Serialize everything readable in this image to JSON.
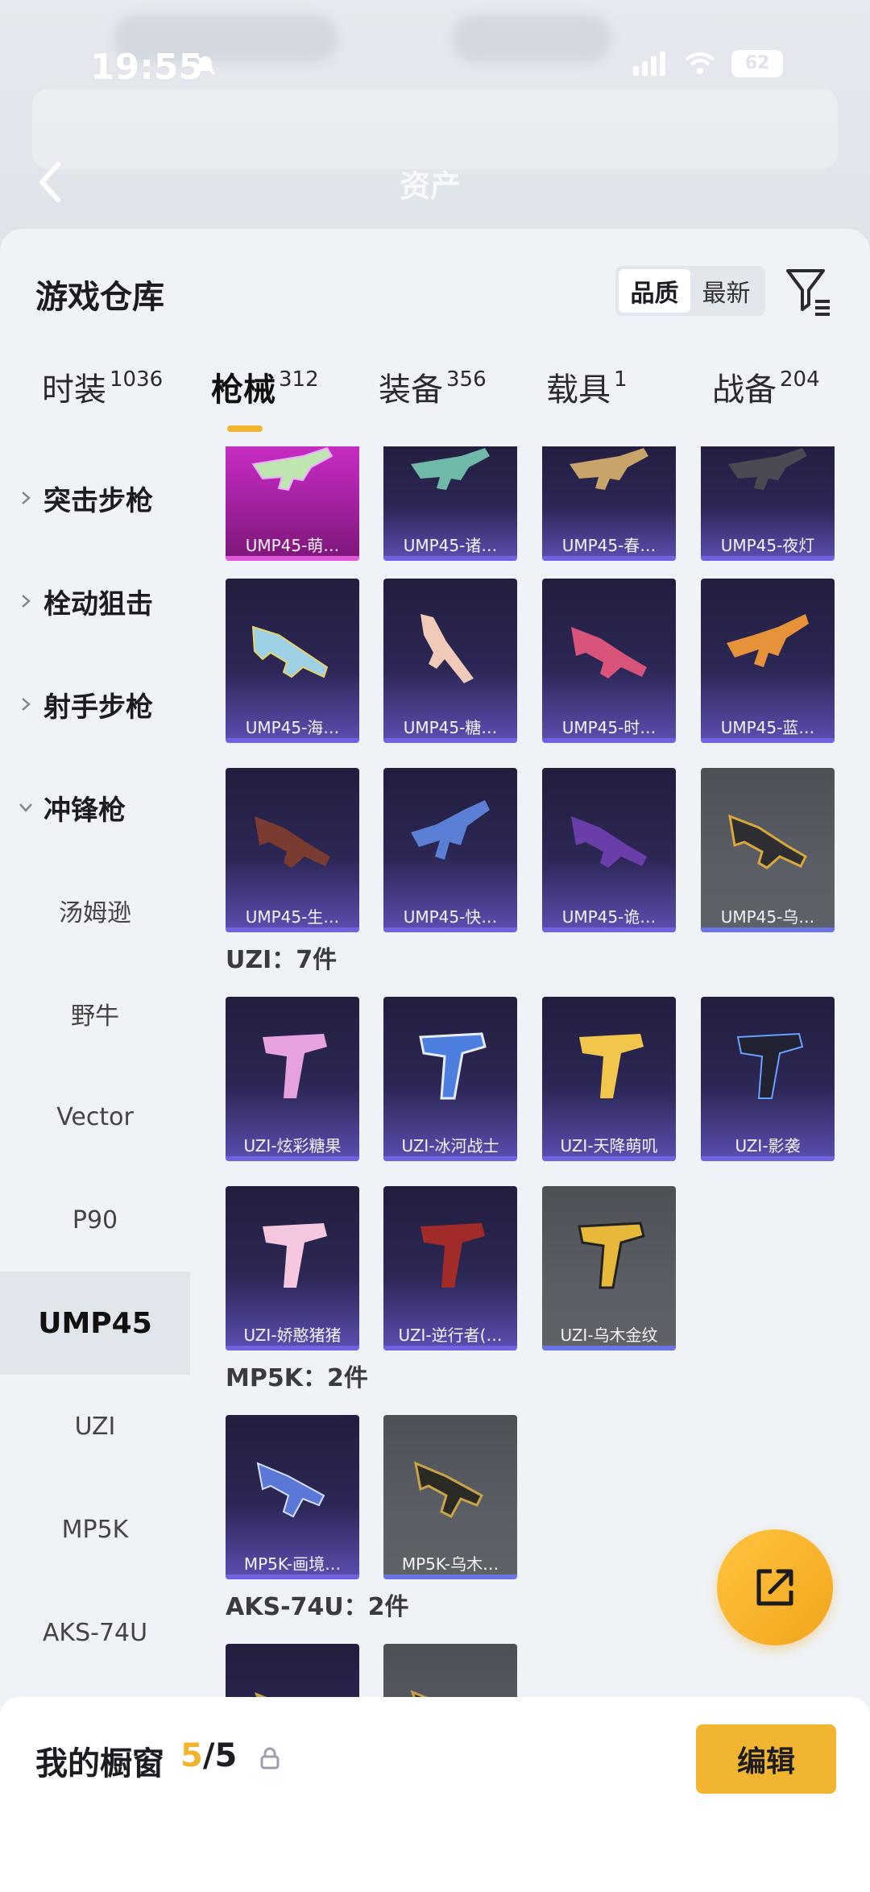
{
  "status": {
    "time": "19:55",
    "battery": "62"
  },
  "header_bg": {
    "left_text": "资产",
    "blurred": [
      "资产"
    ]
  },
  "sheet": {
    "title": "游戏仓库",
    "sort": {
      "options": [
        "品质",
        "最新"
      ],
      "selected": "品质"
    }
  },
  "tabs": [
    {
      "label": "时装",
      "count": "1036"
    },
    {
      "label": "枪械",
      "count": "312"
    },
    {
      "label": "装备",
      "count": "356"
    },
    {
      "label": "载具",
      "count": "1"
    },
    {
      "label": "战备",
      "count": "204"
    }
  ],
  "active_tab": "枪械",
  "sidebar": {
    "categories": [
      {
        "label": "突击步枪",
        "expanded": false
      },
      {
        "label": "栓动狙击",
        "expanded": false
      },
      {
        "label": "射手步枪",
        "expanded": false
      },
      {
        "label": "冲锋枪",
        "expanded": true
      }
    ],
    "subitems": [
      "汤姆逊",
      "野牛",
      "Vector",
      "P90",
      "UMP45",
      "UZI",
      "MP5K",
      "AKS-74U"
    ],
    "selected_sub": "UMP45"
  },
  "grid": {
    "ump_rows": [
      [
        "UMP45-萌…",
        "UMP45-诸…",
        "UMP45-春…",
        "UMP45-夜灯"
      ],
      [
        "UMP45-海…",
        "UMP45-糖…",
        "UMP45-时…",
        "UMP45-蓝…"
      ],
      [
        "UMP45-生…",
        "UMP45-快…",
        "UMP45-诡…",
        "UMP45-乌…"
      ]
    ],
    "uzi_title": "UZI：7件",
    "uzi_rows": [
      [
        "UZI-炫彩糖果",
        "UZI-冰河战士",
        "UZI-天降萌叽",
        "UZI-影袭"
      ],
      [
        "UZI-娇憨猪猪",
        "UZI-逆行者(…",
        "UZI-乌木金纹"
      ]
    ],
    "mp5k_title": "MP5K：2件",
    "mp5k_row": [
      "MP5K-画境…",
      "MP5K-乌木…"
    ],
    "aks_title": "AKS-74U：2件"
  },
  "bottom": {
    "label": "我的橱窗",
    "current": "5",
    "total": "/5",
    "edit_label": "编辑"
  },
  "colors": {
    "accent": "#f0b52e",
    "card_purple": "#2c2755",
    "card_gold": "#ca2ec6",
    "card_gray": "#5b5e65"
  }
}
